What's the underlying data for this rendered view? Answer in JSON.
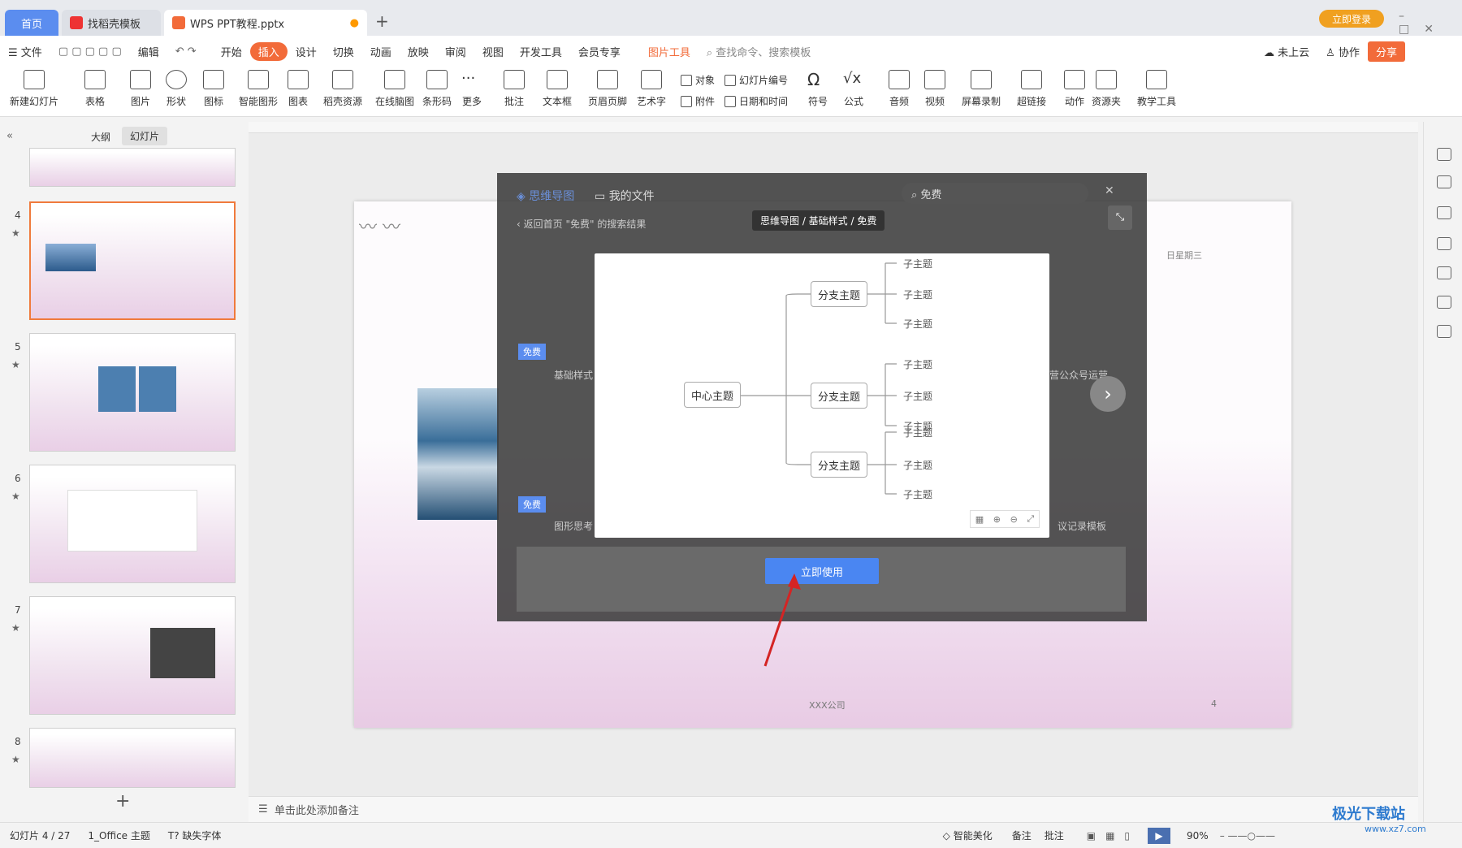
{
  "tabs": {
    "home": "首页",
    "templates": "找稻壳模板",
    "doc": "WPS PPT教程.pptx"
  },
  "titlebar": {
    "login": "立即登录"
  },
  "menu": {
    "file": "文件",
    "edit": "编辑",
    "items": [
      "开始",
      "插入",
      "设计",
      "切换",
      "动画",
      "放映",
      "审阅",
      "视图",
      "开发工具",
      "会员专享"
    ],
    "picture_tools": "图片工具",
    "search": "查找命令、搜索模板",
    "cloud": "未上云",
    "collab": "协作",
    "share": "分享"
  },
  "ribbon": {
    "new_slide": "新建幻灯片",
    "table": "表格",
    "picture": "图片",
    "shape": "形状",
    "icon": "图标",
    "smart": "智能图形",
    "chart": "图表",
    "daoke": "稻壳资源",
    "mindmap": "在线脑图",
    "barcode": "条形码",
    "more": "更多",
    "comment": "批注",
    "textbox": "文本框",
    "header": "页眉页脚",
    "art": "艺术字",
    "object": "对象",
    "attach": "附件",
    "slide_num": "幻灯片编号",
    "datetime": "日期和时间",
    "symbol": "符号",
    "formula": "公式",
    "audio": "音频",
    "video": "视频",
    "record": "屏幕录制",
    "hyperlink": "超链接",
    "action": "动作",
    "assets": "资源夹",
    "teach": "教学工具"
  },
  "panel": {
    "outline": "大纲",
    "slides": "幻灯片",
    "nums": [
      "4",
      "5",
      "6",
      "7",
      "8"
    ]
  },
  "dialog": {
    "tab1": "思维导图",
    "tab2": "我的文件",
    "search": "免费",
    "back": "返回首页",
    "result": "\"免费\" 的搜索结果",
    "breadcrumb": "思维导图 / 基础样式 / 免费",
    "free_badge": "免费",
    "card1": "基础样式",
    "card2": "图形思考",
    "card3": "营公众号运营",
    "card4": "议记录模板",
    "use_button": "立即使用"
  },
  "mindmap": {
    "center": "中心主题",
    "branch": "分支主题",
    "child": "子主题"
  },
  "slide": {
    "company": "XXX公司",
    "date": "日星期三",
    "page": "4"
  },
  "notes": {
    "placeholder": "单击此处添加备注"
  },
  "status": {
    "slide": "幻灯片 4 / 27",
    "theme": "1_Office 主题",
    "font": "缺失字体",
    "beautify": "智能美化",
    "notes": "备注",
    "comment": "批注",
    "zoom": "90%"
  },
  "watermark": {
    "name": "极光下载站",
    "url": "www.xz7.com"
  },
  "colors": {
    "accent": "#5b8def",
    "orange": "#f26b3a",
    "use_btn": "#4a86f2"
  }
}
